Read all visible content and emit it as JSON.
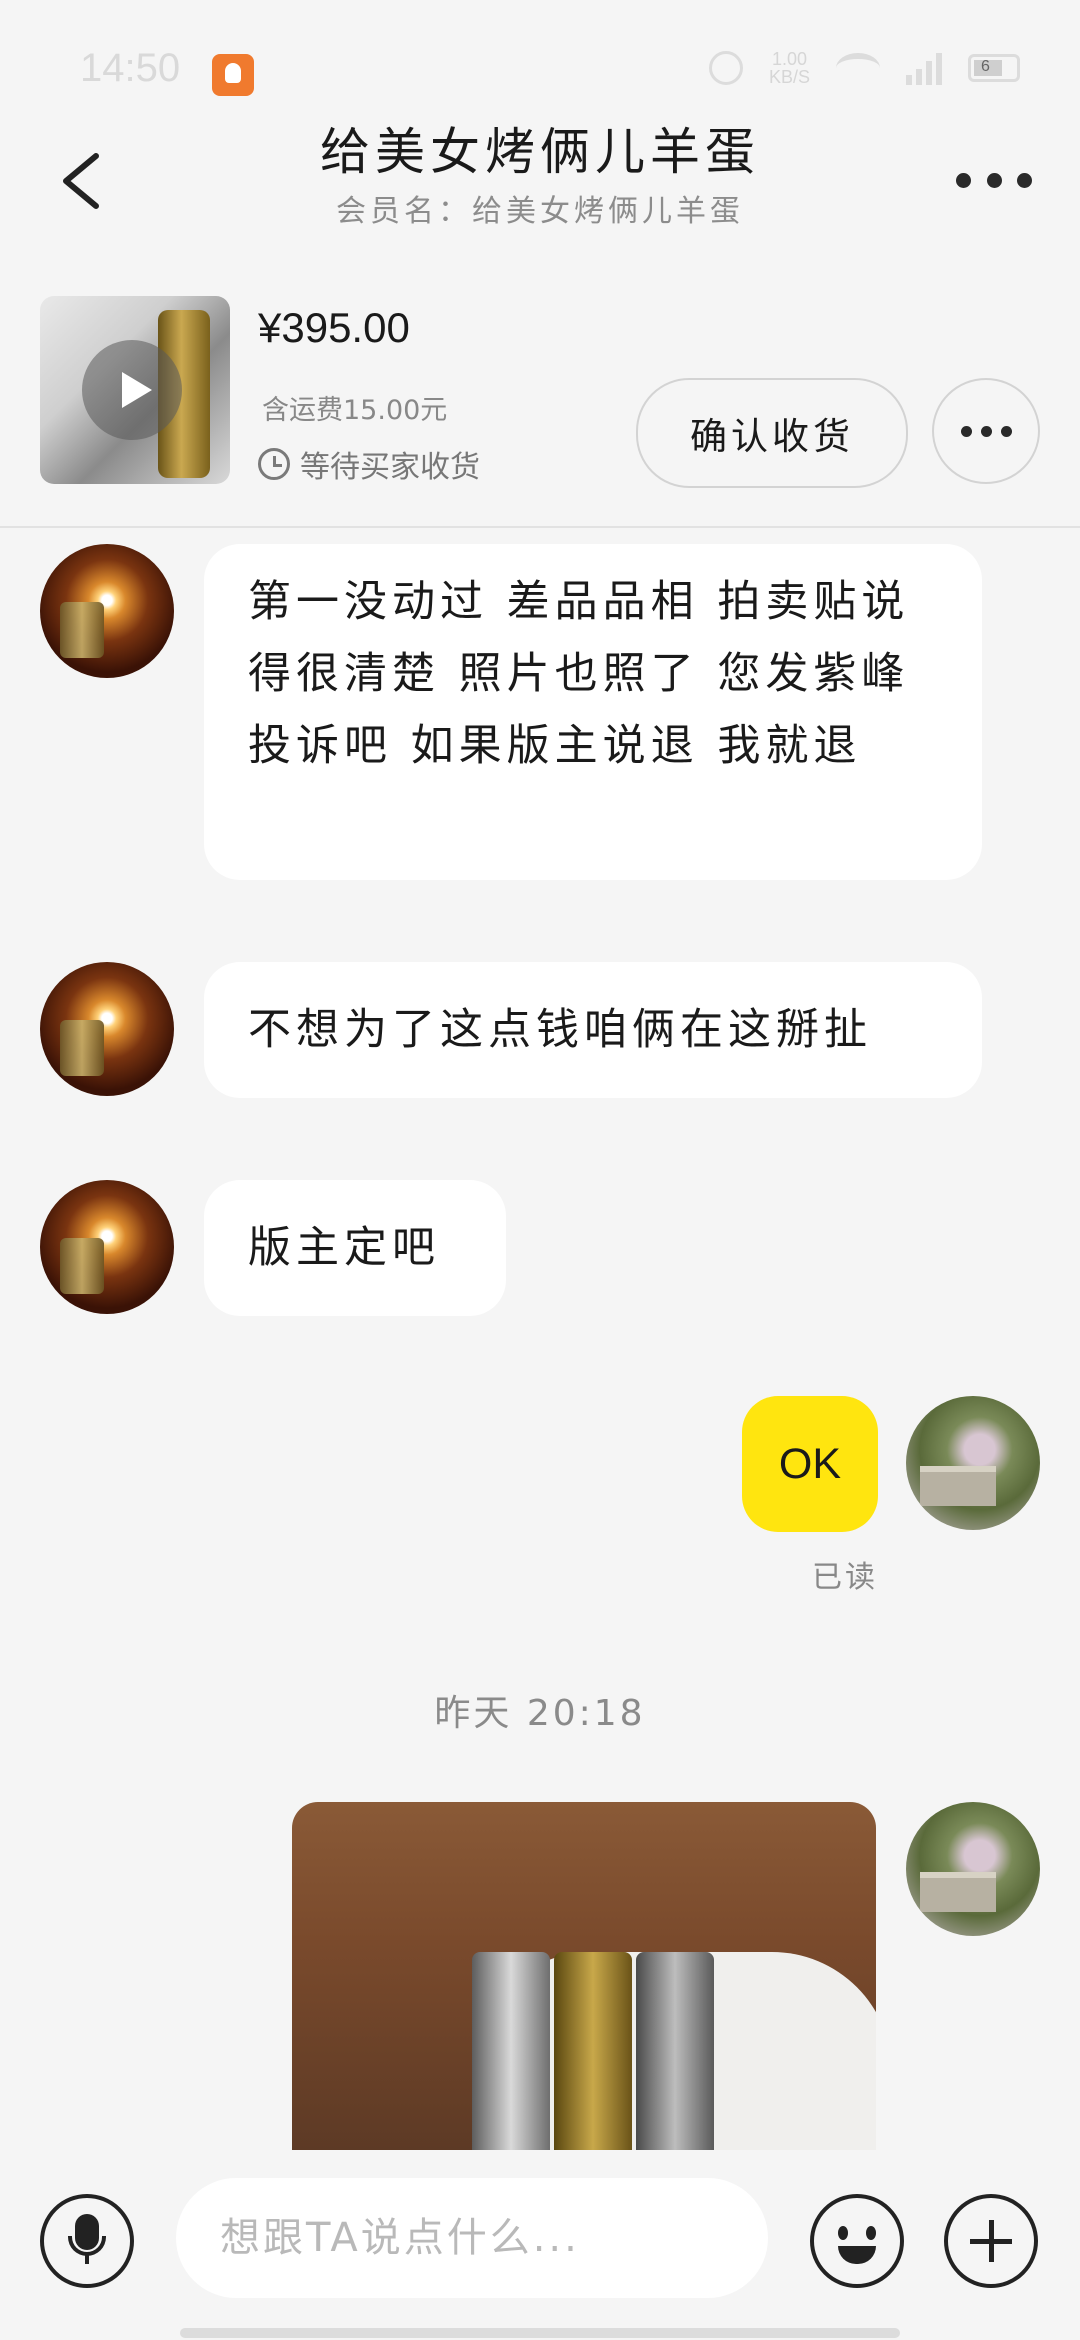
{
  "status_bar": {
    "time": "14:50",
    "network_speed": "1.00\nKB/S",
    "battery_level": "6"
  },
  "header": {
    "title": "给美女烤俩儿羊蛋",
    "subtitle": "会员名：给美女烤俩儿羊蛋"
  },
  "order": {
    "price": "¥395.00",
    "shipping": "含运费15.00元",
    "status": "等待买家收货",
    "confirm_label": "确认收货"
  },
  "messages": [
    {
      "from": "other",
      "text": "第一没动过 差品品相 拍卖贴说得很清楚 照片也照了 您发紫峰投诉吧 如果版主说退 我就退"
    },
    {
      "from": "other",
      "text": "不想为了这点钱咱俩在这掰扯"
    },
    {
      "from": "other",
      "text": "版主定吧"
    },
    {
      "from": "me",
      "text": "OK",
      "receipt": "已读"
    }
  ],
  "timestamp": "昨天 20:18",
  "input": {
    "placeholder": "想跟TA说点什么..."
  },
  "colors": {
    "my_bubble": "#ffe50f",
    "their_bubble": "#ffffff",
    "background": "#f5f5f5"
  }
}
